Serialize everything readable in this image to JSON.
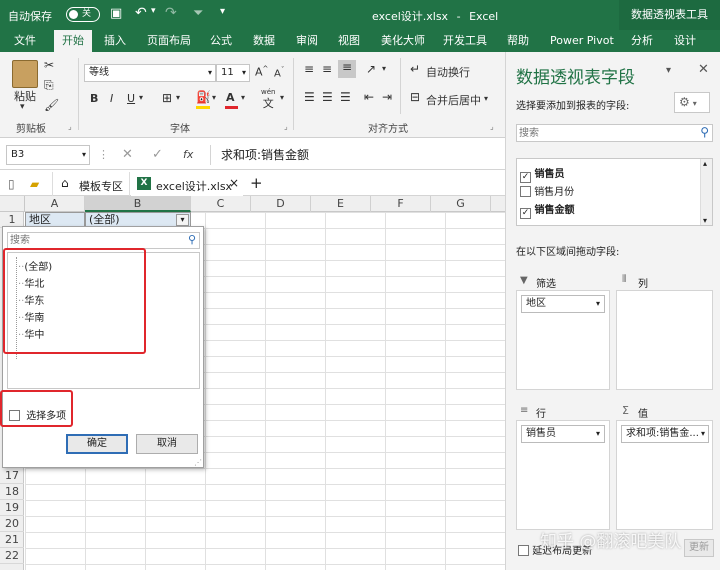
{
  "titlebar": {
    "autosave_label": "自动保存",
    "autosave_state": "关",
    "filename": "excel设计.xlsx",
    "separator": "-",
    "app": "Excel",
    "context_tab": "数据透视表工具"
  },
  "tabs": [
    "文件",
    "开始",
    "插入",
    "页面布局",
    "公式",
    "数据",
    "审阅",
    "视图",
    "美化大师",
    "开发工具",
    "帮助",
    "Power Pivot",
    "分析",
    "设计"
  ],
  "ribbon": {
    "paste": "粘贴",
    "clipboard": "剪贴板",
    "font_name": "等线",
    "font_size": "11",
    "font_group": "字体",
    "wrap_text": "自动换行",
    "merge_center": "合并后居中",
    "align_group": "对齐方式",
    "wen": "wén",
    "wen_char": "文"
  },
  "formula": {
    "namebox": "B3",
    "fx": "fx",
    "content": "求和项:销售金额"
  },
  "doctabs": {
    "template": "模板专区",
    "file": "excel设计.xlsx",
    "close": "×",
    "add": "+"
  },
  "columns": [
    "A",
    "B",
    "C",
    "D",
    "E",
    "F",
    "G"
  ],
  "rows": {
    "top": [
      "1"
    ],
    "bottom": [
      "17",
      "18",
      "19",
      "20",
      "21",
      "22"
    ]
  },
  "cells": {
    "a1": "地区",
    "b1": "(全部)"
  },
  "popup": {
    "search_placeholder": "搜索",
    "items": [
      "(全部)",
      "华北",
      "华东",
      "华南",
      "华中"
    ],
    "multi_select": "选择多项",
    "ok": "确定",
    "cancel": "取消"
  },
  "pane": {
    "title": "数据透视表字段",
    "subtitle": "选择要添加到报表的字段:",
    "search_placeholder": "搜索",
    "fields": [
      {
        "name": "销售员",
        "checked": true
      },
      {
        "name": "销售月份",
        "checked": false
      },
      {
        "name": "销售金额",
        "checked": true
      }
    ],
    "drag_label": "在以下区域间拖动字段:",
    "filter_label": "筛选",
    "column_label": "列",
    "row_label": "行",
    "value_label": "值",
    "filter_item": "地区",
    "row_item": "销售员",
    "value_item": "求和项:销售金...",
    "defer_label": "延迟布局更新",
    "update_button": "更新"
  },
  "watermark": "知乎 @翻滚吧美队",
  "colors": {
    "excel_green": "#217346",
    "highlight_red": "#e0262c"
  }
}
